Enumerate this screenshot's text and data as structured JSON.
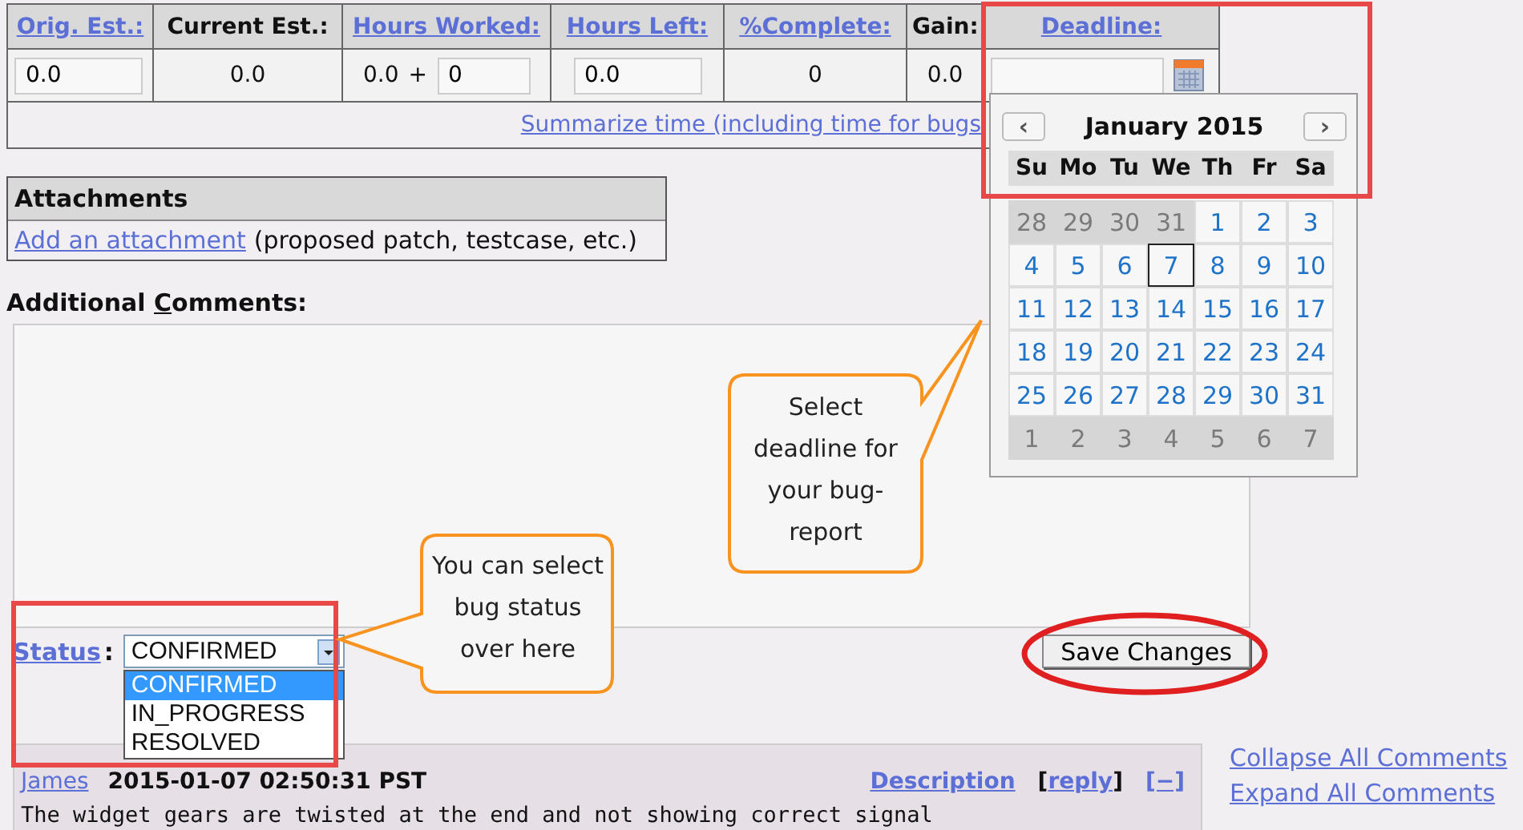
{
  "time_tracking": {
    "columns": [
      {
        "label": "Orig. Est.:",
        "link": true
      },
      {
        "label": "Current Est.:",
        "link": false
      },
      {
        "label": "Hours Worked:",
        "link": true
      },
      {
        "label": "Hours Left:",
        "link": true
      },
      {
        "label": "%Complete:",
        "link": true
      },
      {
        "label": "Gain:",
        "link": false
      },
      {
        "label": "Deadline:",
        "link": true
      }
    ],
    "cells": [
      {
        "kind": "field",
        "value": "0.0"
      },
      {
        "kind": "text",
        "value": "0.0"
      },
      {
        "kind": "sum",
        "value": "0.0",
        "operator": "+",
        "input": "0"
      },
      {
        "kind": "field",
        "value": "0.0"
      },
      {
        "kind": "text",
        "value": "0"
      },
      {
        "kind": "text",
        "value": "0.0"
      },
      {
        "kind": "date"
      }
    ],
    "summarize_link": "Summarize time (including time for bugs"
  },
  "calendar": {
    "prev": "‹",
    "title": "January 2015",
    "next": "›",
    "weekdays": [
      "Su",
      "Mo",
      "Tu",
      "We",
      "Th",
      "Fr",
      "Sa"
    ],
    "weeks": [
      [
        {
          "day": "28",
          "outside": true,
          "selected": false
        },
        {
          "day": "29",
          "outside": true,
          "selected": false
        },
        {
          "day": "30",
          "outside": true,
          "selected": false
        },
        {
          "day": "31",
          "outside": true,
          "selected": false
        },
        {
          "day": "1",
          "outside": false,
          "selected": false
        },
        {
          "day": "2",
          "outside": false,
          "selected": false
        },
        {
          "day": "3",
          "outside": false,
          "selected": false
        }
      ],
      [
        {
          "day": "4",
          "outside": false,
          "selected": false
        },
        {
          "day": "5",
          "outside": false,
          "selected": false
        },
        {
          "day": "6",
          "outside": false,
          "selected": false
        },
        {
          "day": "7",
          "outside": false,
          "selected": true
        },
        {
          "day": "8",
          "outside": false,
          "selected": false
        },
        {
          "day": "9",
          "outside": false,
          "selected": false
        },
        {
          "day": "10",
          "outside": false,
          "selected": false
        }
      ],
      [
        {
          "day": "11",
          "outside": false,
          "selected": false
        },
        {
          "day": "12",
          "outside": false,
          "selected": false
        },
        {
          "day": "13",
          "outside": false,
          "selected": false
        },
        {
          "day": "14",
          "outside": false,
          "selected": false
        },
        {
          "day": "15",
          "outside": false,
          "selected": false
        },
        {
          "day": "16",
          "outside": false,
          "selected": false
        },
        {
          "day": "17",
          "outside": false,
          "selected": false
        }
      ],
      [
        {
          "day": "18",
          "outside": false,
          "selected": false
        },
        {
          "day": "19",
          "outside": false,
          "selected": false
        },
        {
          "day": "20",
          "outside": false,
          "selected": false
        },
        {
          "day": "21",
          "outside": false,
          "selected": false
        },
        {
          "day": "22",
          "outside": false,
          "selected": false
        },
        {
          "day": "23",
          "outside": false,
          "selected": false
        },
        {
          "day": "24",
          "outside": false,
          "selected": false
        }
      ],
      [
        {
          "day": "25",
          "outside": false,
          "selected": false
        },
        {
          "day": "26",
          "outside": false,
          "selected": false
        },
        {
          "day": "27",
          "outside": false,
          "selected": false
        },
        {
          "day": "28",
          "outside": false,
          "selected": false
        },
        {
          "day": "29",
          "outside": false,
          "selected": false
        },
        {
          "day": "30",
          "outside": false,
          "selected": false
        },
        {
          "day": "31",
          "outside": false,
          "selected": false
        }
      ],
      [
        {
          "day": "1",
          "outside": true,
          "selected": false
        },
        {
          "day": "2",
          "outside": true,
          "selected": false
        },
        {
          "day": "3",
          "outside": true,
          "selected": false
        },
        {
          "day": "4",
          "outside": true,
          "selected": false
        },
        {
          "day": "5",
          "outside": true,
          "selected": false
        },
        {
          "day": "6",
          "outside": true,
          "selected": false
        },
        {
          "day": "7",
          "outside": true,
          "selected": false
        }
      ]
    ]
  },
  "attachments": {
    "title": "Attachments",
    "link": "Add an attachment",
    "note": "(proposed patch, testcase, etc.)"
  },
  "comments_label": {
    "before": "Additional ",
    "access_key": "C",
    "after": "omments:"
  },
  "status": {
    "label": "Status",
    "colon": ":",
    "value": "CONFIRMED",
    "options": [
      {
        "label": "CONFIRMED",
        "selected": true
      },
      {
        "label": "IN_PROGRESS",
        "selected": false
      },
      {
        "label": "RESOLVED",
        "selected": false
      }
    ]
  },
  "save_button": "Save Changes",
  "comment": {
    "author": "James",
    "time": "2015-01-07 02:50:31 PST",
    "description": "Description",
    "reply_open": "[",
    "reply": "reply",
    "reply_close": "]",
    "toggle": "[−]",
    "text": "The widget gears are twisted at the end and not showing correct signal"
  },
  "side_links": [
    "Collapse All Comments",
    "Expand All Comments"
  ],
  "callouts": [
    {
      "kind": "deadline",
      "text": "Select deadline for your bug-report"
    },
    {
      "kind": "status",
      "text": "You can select bug status over here"
    }
  ]
}
